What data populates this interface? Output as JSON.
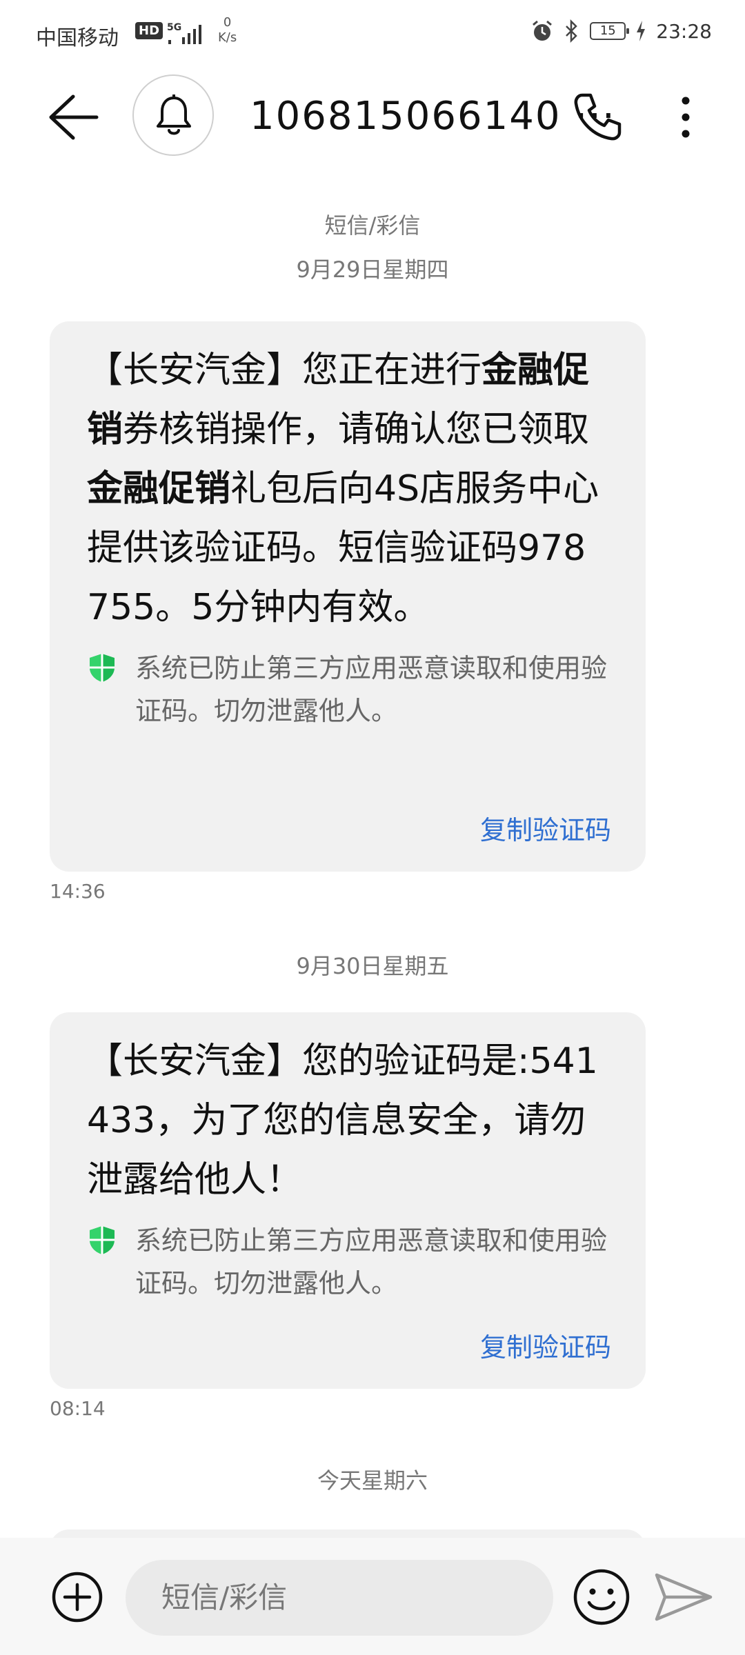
{
  "status_bar": {
    "carrier": "中国移动",
    "hd": "HD",
    "speed_value": "0",
    "speed_unit": "K/s",
    "battery": "15",
    "time": "23:28"
  },
  "header": {
    "contact": "106815066140 ···"
  },
  "thread": {
    "label": "短信/彩信",
    "security_note": "系统已防止第三方应用恶意读取和使用验证码。切勿泄露他人。",
    "copy_label": "复制验证码",
    "dates": {
      "d1": "9月29日星期四",
      "d2": "9月30日星期五",
      "d3": "今天星期六"
    },
    "messages": [
      {
        "t1": "【长安汽金】您正在进行",
        "b1": "金融促销",
        "t2": "券核销操作，请确认您已领取",
        "b2": "金融促销",
        "t3": "礼包后向4S店服务中心提供该验证码。短信验证码978755。5分钟内有效。",
        "time": "14:36"
      },
      {
        "text": "【长安汽金】您的验证码是:541433，为了您的信息安全，请勿泄露给他人！",
        "time": "08:14"
      }
    ]
  },
  "input": {
    "placeholder": "短信/彩信"
  },
  "colors": {
    "link": "#2f6fd1",
    "shield": "#1db954",
    "bubble": "#f1f1f1"
  }
}
